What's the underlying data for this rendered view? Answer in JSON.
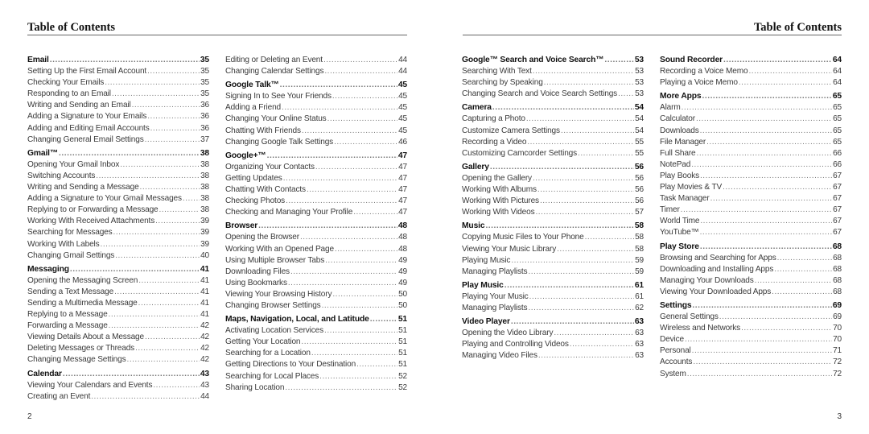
{
  "header": {
    "left_title": "Table of Contents",
    "right_title": "Table of Contents"
  },
  "footer": {
    "left_page": "2",
    "right_page": "3"
  },
  "columns": [
    [
      {
        "title": "Email",
        "page": "35",
        "items": [
          [
            "Setting Up the First Email Account",
            "35"
          ],
          [
            "Checking Your Emails",
            "35"
          ],
          [
            "Responding to an Email",
            "35"
          ],
          [
            "Writing and Sending an Email",
            "36"
          ],
          [
            "Adding a Signature to Your Emails",
            "36"
          ],
          [
            "Adding and Editing Email Accounts",
            "36"
          ],
          [
            "Changing General Email Settings",
            "37"
          ]
        ]
      },
      {
        "title": "Gmail™",
        "page": "38",
        "items": [
          [
            "Opening Your Gmail Inbox",
            "38"
          ],
          [
            "Switching Accounts",
            "38"
          ],
          [
            "Writing and Sending a Message",
            "38"
          ],
          [
            "Adding a Signature to Your Gmail Messages",
            "38"
          ],
          [
            "Replying to or Forwarding a Message",
            "38"
          ],
          [
            "Working With Received Attachments",
            "39"
          ],
          [
            "Searching for Messages",
            "39"
          ],
          [
            "Working With Labels",
            "39"
          ],
          [
            "Changing Gmail Settings",
            "40"
          ]
        ]
      },
      {
        "title": "Messaging",
        "page": "41",
        "items": [
          [
            "Opening the Messaging Screen",
            "41"
          ],
          [
            "Sending a Text Message",
            "41"
          ],
          [
            "Sending a Multimedia Message",
            "41"
          ],
          [
            "Replying to a Message",
            "41"
          ],
          [
            "Forwarding a Message",
            "42"
          ],
          [
            "Viewing Details About a Message",
            "42"
          ],
          [
            "Deleting Messages or Threads",
            "42"
          ],
          [
            "Changing Message Settings",
            "42"
          ]
        ]
      },
      {
        "title": "Calendar",
        "page": "43",
        "items": [
          [
            "Viewing Your Calendars and Events",
            "43"
          ],
          [
            "Creating an Event",
            "44"
          ]
        ]
      }
    ],
    [
      {
        "title": null,
        "page": null,
        "items": [
          [
            "Editing or Deleting an Event",
            "44"
          ],
          [
            "Changing Calendar Settings",
            "44"
          ]
        ]
      },
      {
        "title": "Google Talk™",
        "page": "45",
        "items": [
          [
            "Signing In to See Your Friends",
            "45"
          ],
          [
            "Adding a Friend",
            "45"
          ],
          [
            "Changing Your Online Status",
            "45"
          ],
          [
            "Chatting With Friends",
            "45"
          ],
          [
            "Changing Google Talk Settings",
            "46"
          ]
        ]
      },
      {
        "title": "Google+™",
        "page": "47",
        "items": [
          [
            "Organizing Your Contacts",
            "47"
          ],
          [
            "Getting Updates",
            "47"
          ],
          [
            "Chatting With Contacts",
            "47"
          ],
          [
            "Checking Photos",
            "47"
          ],
          [
            "Checking and Managing Your Profile",
            "47"
          ]
        ]
      },
      {
        "title": "Browser",
        "page": "48",
        "items": [
          [
            "Opening the Browser",
            "48"
          ],
          [
            "Working With an Opened Page",
            "48"
          ],
          [
            "Using Multiple Browser Tabs",
            "49"
          ],
          [
            "Downloading Files",
            "49"
          ],
          [
            "Using Bookmarks",
            "49"
          ],
          [
            "Viewing Your Browsing History",
            "50"
          ],
          [
            "Changing Browser Settings",
            "50"
          ]
        ]
      },
      {
        "title": "Maps, Navigation, Local, and Latitude",
        "page": "51",
        "items": [
          [
            "Activating Location Services",
            "51"
          ],
          [
            "Getting Your Location",
            "51"
          ],
          [
            "Searching for a Location",
            "51"
          ],
          [
            "Getting Directions to Your Destination",
            "51"
          ],
          [
            "Searching for Local Places",
            "52"
          ],
          [
            "Sharing Location",
            "52"
          ]
        ]
      }
    ],
    [
      {
        "title": "Google™ Search and Voice Search™",
        "page": "53",
        "items": [
          [
            "Searching With Text",
            "53"
          ],
          [
            "Searching by Speaking",
            "53"
          ],
          [
            "Changing Search and Voice Search Settings",
            "53"
          ]
        ]
      },
      {
        "title": "Camera",
        "page": "54",
        "items": [
          [
            "Capturing a Photo",
            "54"
          ],
          [
            "Customize Camera Settings",
            "54"
          ],
          [
            "Recording a Video",
            "55"
          ],
          [
            "Customizing Camcorder Settings",
            "55"
          ]
        ]
      },
      {
        "title": "Gallery",
        "page": "56",
        "items": [
          [
            "Opening the Gallery",
            "56"
          ],
          [
            "Working With Albums",
            "56"
          ],
          [
            "Working With Pictures",
            "56"
          ],
          [
            "Working With Videos",
            "57"
          ]
        ]
      },
      {
        "title": "Music",
        "page": "58",
        "items": [
          [
            "Copying Music Files to Your Phone",
            "58"
          ],
          [
            "Viewing Your Music Library",
            "58"
          ],
          [
            "Playing Music",
            "59"
          ],
          [
            "Managing Playlists",
            "59"
          ]
        ]
      },
      {
        "title": "Play Music",
        "page": "61",
        "items": [
          [
            "Playing Your Music",
            "61"
          ],
          [
            "Managing Playlists",
            "62"
          ]
        ]
      },
      {
        "title": "Video Player",
        "page": "63",
        "items": [
          [
            "Opening the Video Library",
            "63"
          ],
          [
            "Playing and Controlling Videos",
            "63"
          ],
          [
            "Managing Video Files",
            "63"
          ]
        ]
      }
    ],
    [
      {
        "title": "Sound Recorder",
        "page": "64",
        "items": [
          [
            "Recording a Voice Memo",
            "64"
          ],
          [
            "Playing a Voice Memo",
            "64"
          ]
        ]
      },
      {
        "title": "More Apps",
        "page": "65",
        "items": [
          [
            "Alarm",
            "65"
          ],
          [
            "Calculator",
            "65"
          ],
          [
            "Downloads",
            "65"
          ],
          [
            "File Manager",
            "65"
          ],
          [
            "Full Share",
            "66"
          ],
          [
            "NotePad",
            "66"
          ],
          [
            "Play Books",
            "67"
          ],
          [
            "Play Movies & TV",
            "67"
          ],
          [
            "Task Manager",
            "67"
          ],
          [
            "Timer",
            "67"
          ],
          [
            "World Time",
            "67"
          ],
          [
            "YouTube™",
            "67"
          ]
        ]
      },
      {
        "title": "Play Store",
        "page": "68",
        "items": [
          [
            "Browsing and Searching for Apps",
            "68"
          ],
          [
            "Downloading and Installing Apps",
            "68"
          ],
          [
            "Managing Your Downloads",
            "68"
          ],
          [
            "Viewing Your Downloaded Apps",
            "68"
          ]
        ]
      },
      {
        "title": "Settings",
        "page": "69",
        "items": [
          [
            "General Settings",
            "69"
          ],
          [
            "Wireless and Networks",
            "70"
          ],
          [
            "Device",
            "70"
          ],
          [
            "Personal",
            "71"
          ],
          [
            "Accounts",
            "72"
          ],
          [
            "System",
            "72"
          ]
        ]
      }
    ]
  ]
}
